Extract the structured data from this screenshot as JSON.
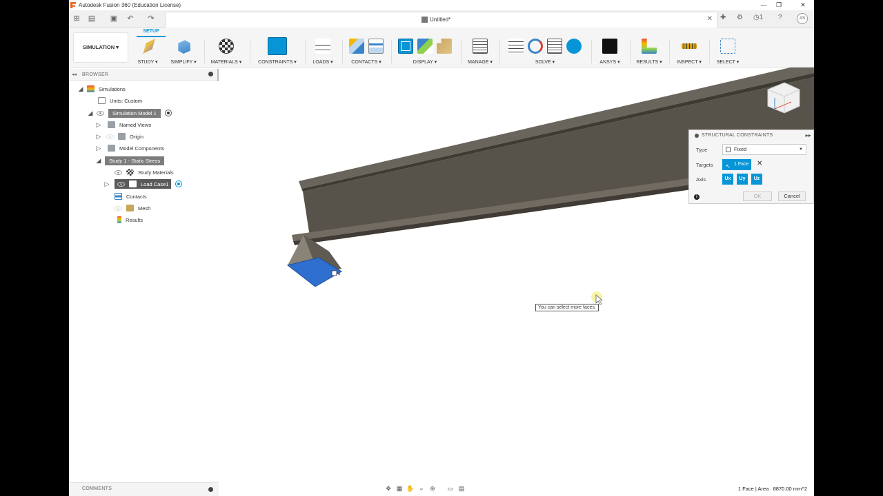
{
  "window": {
    "title": "Autodesk Fusion 360 (Education License)"
  },
  "document": {
    "tab_name": "Untitled*"
  },
  "user": {
    "initials": "AS",
    "jobs_count": "1"
  },
  "ribbon": {
    "workspace": "SIMULATION",
    "active_tab": "SETUP",
    "groups": [
      {
        "label": "STUDY"
      },
      {
        "label": "SIMPLIFY"
      },
      {
        "label": "MATERIALS"
      },
      {
        "label": "CONSTRAINTS"
      },
      {
        "label": "LOADS"
      },
      {
        "label": "CONTACTS"
      },
      {
        "label": "DISPLAY"
      },
      {
        "label": "MANAGE"
      },
      {
        "label": "SOLVE"
      },
      {
        "label": "ANSYS"
      },
      {
        "label": "RESULTS"
      },
      {
        "label": "INSPECT"
      },
      {
        "label": "SELECT"
      }
    ]
  },
  "browser": {
    "title": "BROWSER",
    "items": [
      {
        "label": "Simulations"
      },
      {
        "label": "Units: Custom"
      },
      {
        "label": "Simulation Model 1"
      },
      {
        "label": "Named Views"
      },
      {
        "label": "Origin"
      },
      {
        "label": "Model Components"
      },
      {
        "label": "Study 1 - Static Stress"
      },
      {
        "label": "Study Materials"
      },
      {
        "label": "Load Case1"
      },
      {
        "label": "Contacts"
      },
      {
        "label": "Mesh"
      },
      {
        "label": "Results"
      }
    ]
  },
  "dialog": {
    "title": "STRUCTURAL CONSTRAINTS",
    "type_label": "Type",
    "type_value": "Fixed",
    "targets_label": "Targets",
    "targets_value": "1 Face",
    "axis_label": "Axis",
    "axes": [
      "Ux",
      "Uy",
      "Uz"
    ],
    "ok_label": "OK",
    "cancel_label": "Cancel"
  },
  "tooltip": {
    "text": "You can select more faces."
  },
  "comments": {
    "title": "COMMENTS"
  },
  "status": {
    "text": "1 Face | Area : 8870.00 mm^2"
  },
  "colors": {
    "accent": "#0696d7",
    "beam": "#5f5a52",
    "selected_face": "#2f6fd0"
  }
}
